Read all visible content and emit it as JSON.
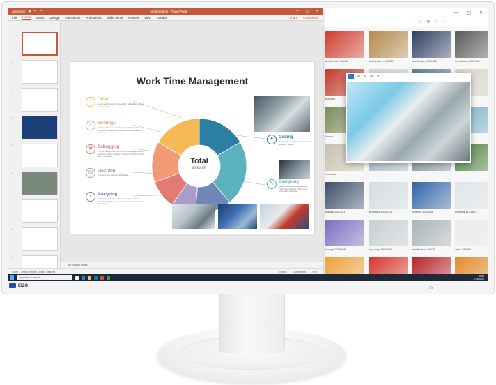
{
  "ppt": {
    "title": "presentation - PowerPoint",
    "autosave": "AutoSave",
    "menu": [
      "File",
      "Home",
      "Insert",
      "Design",
      "Transitions",
      "Animations",
      "Slide Show",
      "Review",
      "View",
      "Acrobat"
    ],
    "share": "Share",
    "comments": "Comments",
    "notes_placeholder": "Tap to add notes",
    "status_left": "Slide 1 of 9    English (United States)",
    "status_notes": "Notes",
    "status_comments": "Comments",
    "zoom": "70%"
  },
  "slide": {
    "title": "Work Time Management",
    "center_title": "Total",
    "center_sub": "amount",
    "items": [
      {
        "label": "Other",
        "desc": "Supervise the world of productivity, scheduling as you like business."
      },
      {
        "label": "Meetings",
        "desc": "Discuss with customers and professionals sphere. Ensure that the system improves for the daily team business."
      },
      {
        "label": "Debugging",
        "desc": "The first answer is on the hunt, and debugged system going live. Mobile working solutions is to look on to the best of ourselves."
      },
      {
        "label": "Learning",
        "desc": "Enter any new various technologies."
      },
      {
        "label": "Analyzing",
        "desc": "Analyze project data to determine opportunities to improve the business, and how to react effectively to the business."
      },
      {
        "label": "Coding",
        "desc": "Produce the real part of software and developer sphere."
      },
      {
        "label": "Designing",
        "desc": "Design software and applications. Follow the customer sphere and improve the business."
      }
    ],
    "colors": {
      "other": "#f7b955",
      "meetings": "#f19a73",
      "debugging": "#e27b74",
      "learning": "#a99cc8",
      "analyzing": "#6e86b8",
      "coding": "#2c7ea3",
      "designing": "#5bb1bd"
    }
  },
  "viewer": {
    "title_btns": [
      "—",
      "▢",
      "✕"
    ],
    "toolbar": [
      "☆",
      "⟳",
      "⤢",
      "⋯"
    ],
    "captions": [
      "architecture-13400",
      "architecture-164950",
      "architecture-229488",
      "architecture-237733",
      "bubbles",
      "",
      "",
      "library-2127",
      "library",
      "",
      "",
      "",
      "meadow",
      "",
      "",
      "",
      "blanks-1100401",
      "airplanes-1042123",
      "meeting-1266486",
      "meeting-1173464",
      "lounge-2200209",
      "daycamp-1961105",
      "architecture-20029",
      "desk-978984",
      "furniture-852017",
      "back-to-school-1289014",
      "meeting-1390460",
      "industry-1101661",
      "desks-1168897",
      "interior-1778975",
      "machine-483870",
      "meeting-1179464"
    ]
  },
  "taskbar": {
    "search": "Type here to search",
    "time": "10:51",
    "date": "1/14/2020"
  },
  "monitor": {
    "brand": "EIZO"
  }
}
